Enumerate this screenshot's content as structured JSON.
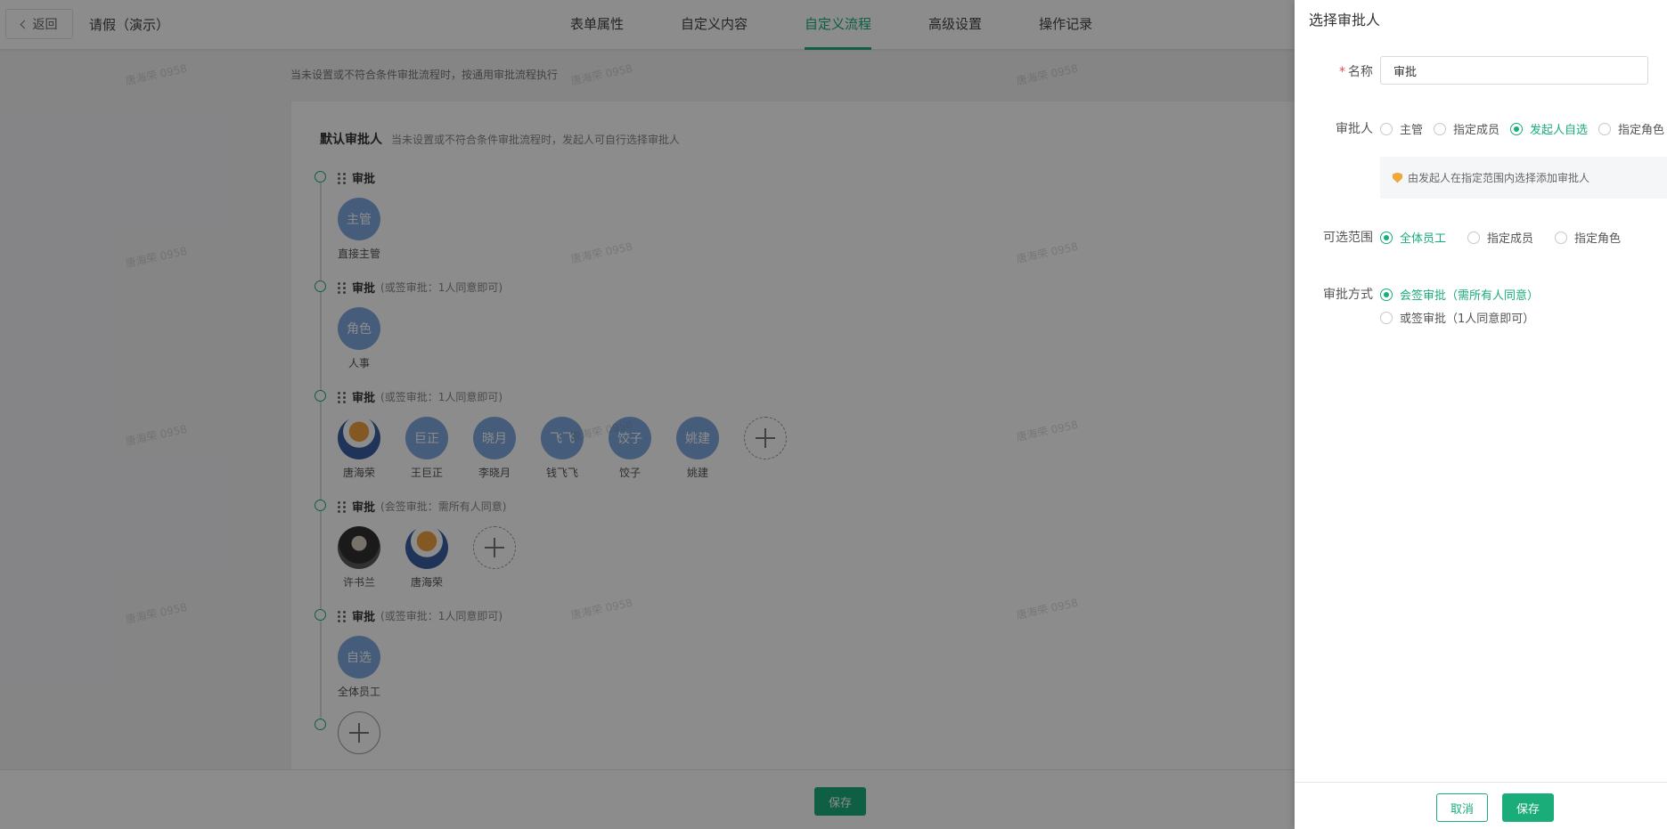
{
  "header": {
    "back_label": "返回",
    "page_name": "请假（演示）",
    "tabs": [
      {
        "label": "表单属性"
      },
      {
        "label": "自定义内容"
      },
      {
        "label": "自定义流程"
      },
      {
        "label": "高级设置"
      },
      {
        "label": "操作记录"
      }
    ],
    "active_tab": "自定义流程"
  },
  "hint": "当未设置或不符合条件审批流程时，按通用审批流程执行",
  "flow": {
    "title": "默认审批人",
    "description": "当未设置或不符合条件审批流程时，发起人可自行选择审批人",
    "steps": [
      {
        "name": "审批",
        "mode": "",
        "members": [
          {
            "avatar_text": "主管",
            "label": "直接主管"
          }
        ]
      },
      {
        "name": "审批",
        "mode": "(或签审批：1人同意即可)",
        "members": [
          {
            "avatar_text": "角色",
            "label": "人事"
          }
        ]
      },
      {
        "name": "审批",
        "mode": "(或签审批：1人同意即可)",
        "members": [
          {
            "avatar_text": "",
            "label": "唐海荣"
          },
          {
            "avatar_text": "巨正",
            "label": "王巨正"
          },
          {
            "avatar_text": "晓月",
            "label": "李晓月"
          },
          {
            "avatar_text": "飞飞",
            "label": "钱飞飞"
          },
          {
            "avatar_text": "饺子",
            "label": "饺子"
          },
          {
            "avatar_text": "姚建",
            "label": "姚建"
          }
        ]
      },
      {
        "name": "审批",
        "mode": "(会签审批：需所有人同意)",
        "members": [
          {
            "avatar_text": "",
            "label": "许书兰"
          },
          {
            "avatar_text": "",
            "label": "唐海荣"
          }
        ]
      },
      {
        "name": "审批",
        "mode": "(或签审批：1人同意即可)",
        "members": [
          {
            "avatar_text": "自选",
            "label": "全体员工"
          }
        ]
      }
    ]
  },
  "bottom": {
    "save_label": "保存"
  },
  "drawer": {
    "title": "选择审批人",
    "name_label": "名称",
    "name_value": "审批",
    "approver_label": "审批人",
    "approver_options": [
      "主管",
      "指定成员",
      "发起人自选",
      "指定角色"
    ],
    "approver_selected": "发起人自选",
    "info_text": "由发起人在指定范围内选择添加审批人",
    "scope_label": "可选范围",
    "scope_options": [
      "全体员工",
      "指定成员",
      "指定角色"
    ],
    "scope_selected": "全体员工",
    "method_label": "审批方式",
    "method_options": [
      "会签审批（需所有人同意）",
      "或签审批（1人同意即可）"
    ],
    "method_selected": "会签审批（需所有人同意）",
    "cancel_label": "取消",
    "save_label": "保存"
  },
  "watermark": "唐海荣 0958",
  "colors": {
    "accent": "#1aad7a",
    "avatar": "#7fa9de",
    "required": "#e5484d",
    "info_icon": "#f0a83a"
  }
}
